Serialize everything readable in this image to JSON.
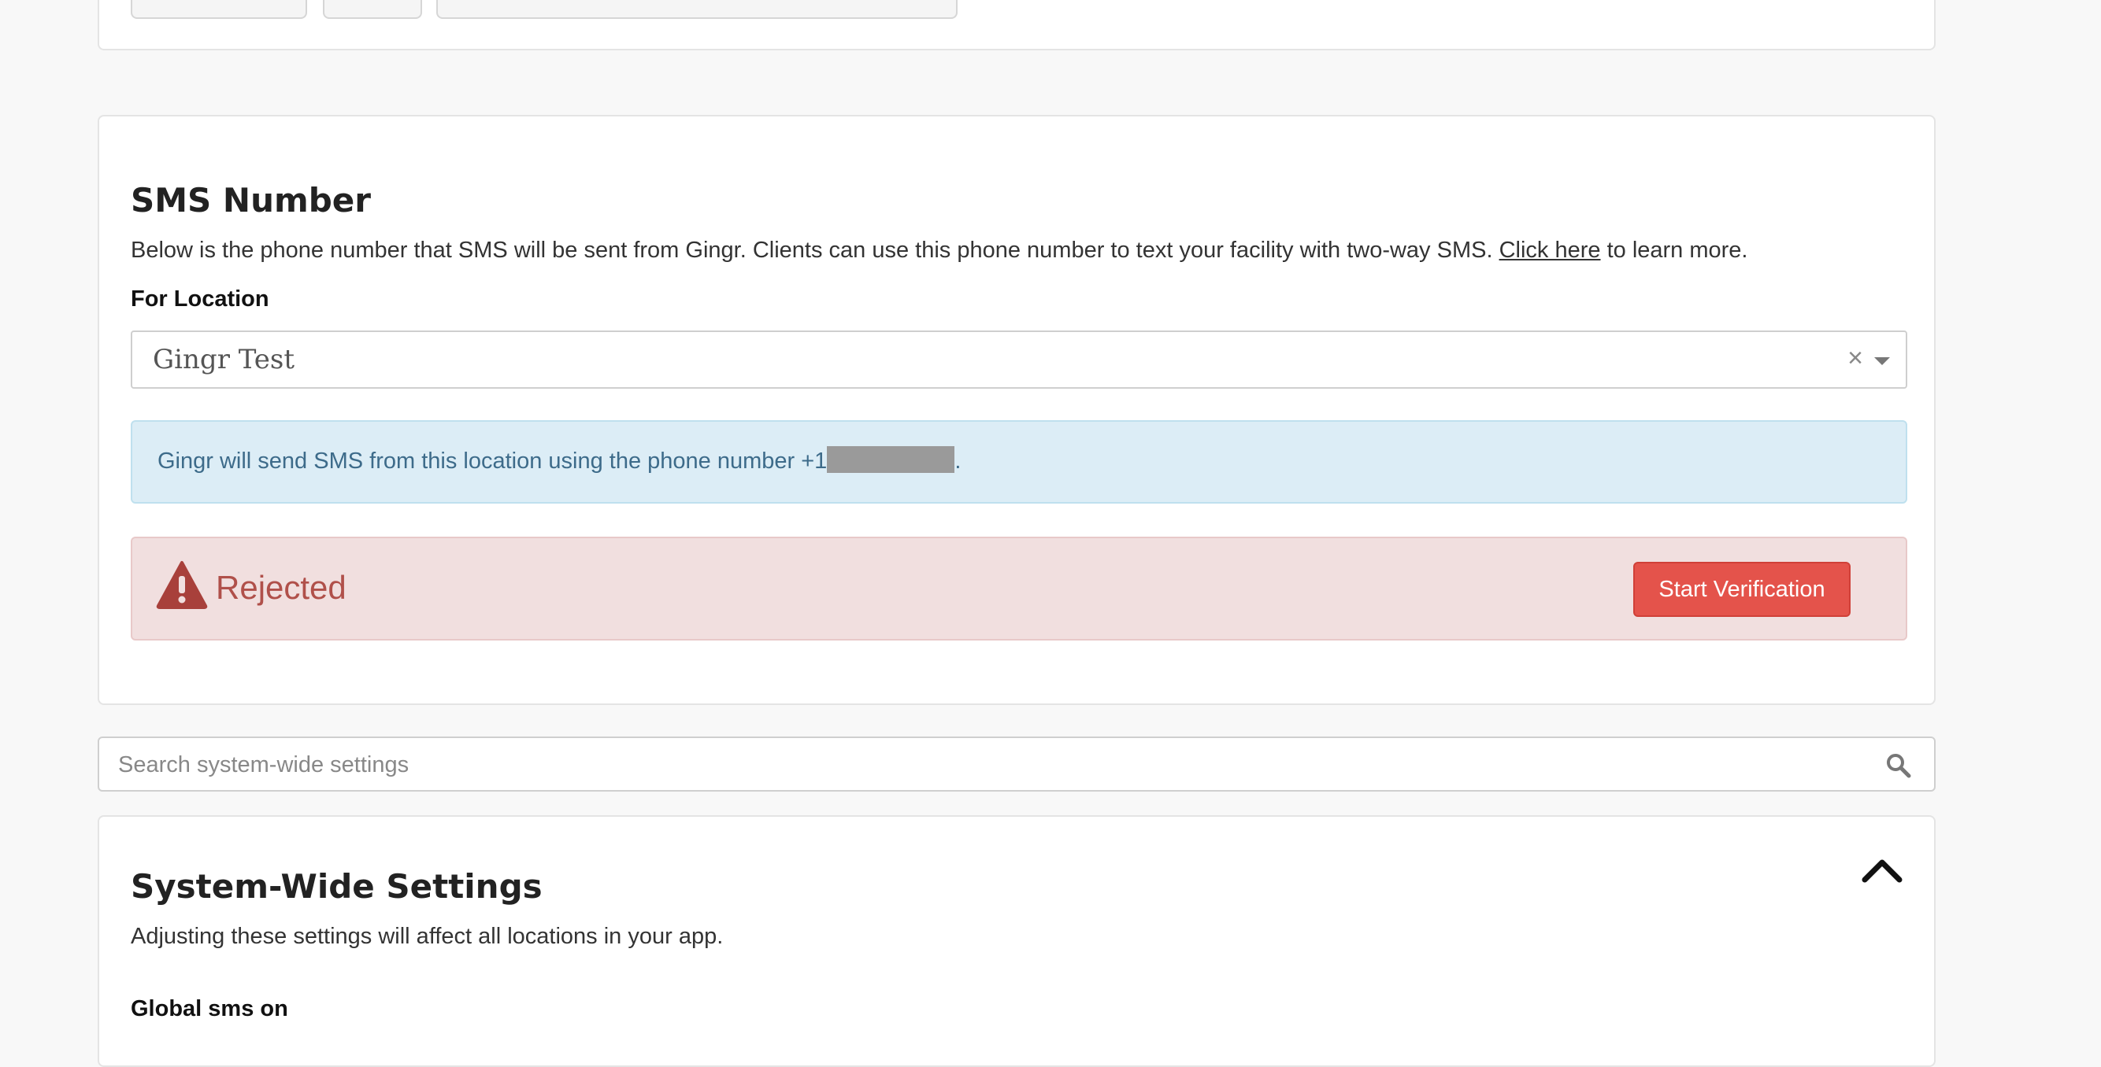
{
  "sms_number": {
    "title": "SMS Number",
    "description_before": "Below is the phone number that SMS will be sent from Gingr. Clients can use this phone number to text your facility with two-way SMS. ",
    "description_link": "Click here",
    "description_after": " to learn more.",
    "location_label": "For Location",
    "location_value": "Gingr Test",
    "clear_glyph": "×",
    "info_text_before": "Gingr will send SMS from this location using the phone number +1",
    "info_text_after": ".",
    "status_text": "Rejected",
    "verify_button": "Start Verification"
  },
  "search": {
    "placeholder": "Search system-wide settings"
  },
  "system_wide": {
    "title": "System-Wide Settings",
    "description": "Adjusting these settings will affect all locations in your app.",
    "first_setting_label": "Global sms on"
  },
  "colors": {
    "danger": "#e4534b",
    "info_bg": "#dcedf6",
    "alert_bg": "#f1dfdf"
  },
  "icons": [
    "warning-icon",
    "search-icon",
    "chevron-up-icon",
    "close-icon",
    "caret-down-icon"
  ]
}
